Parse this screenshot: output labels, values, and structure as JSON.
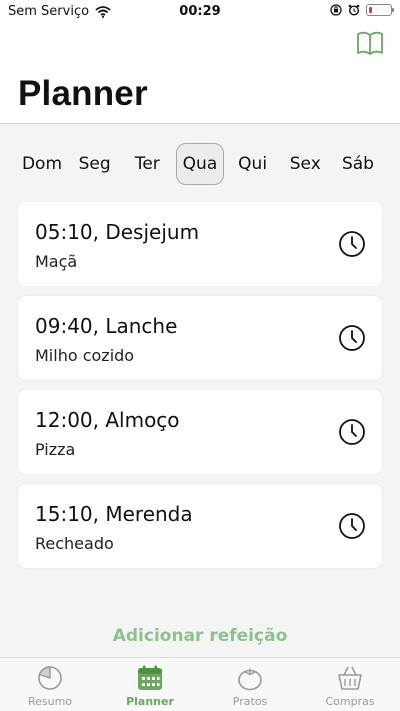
{
  "status_bar": {
    "carrier": "Sem Serviço",
    "time": "00:29"
  },
  "header": {
    "title": "Planner",
    "icon": "book-icon"
  },
  "days": [
    {
      "label": "Dom",
      "active": false
    },
    {
      "label": "Seg",
      "active": false
    },
    {
      "label": "Ter",
      "active": false
    },
    {
      "label": "Qua",
      "active": true
    },
    {
      "label": "Qui",
      "active": false
    },
    {
      "label": "Sex",
      "active": false
    },
    {
      "label": "Sáb",
      "active": false
    }
  ],
  "meals": [
    {
      "title": "05:10, Desjejum",
      "food": "Maçã"
    },
    {
      "title": "09:40, Lanche",
      "food": "Milho cozido"
    },
    {
      "title": "12:00, Almoço",
      "food": "Pizza"
    },
    {
      "title": "15:10, Merenda",
      "food": "Recheado"
    }
  ],
  "add_meal_label": "Adicionar refeição",
  "tabs": [
    {
      "label": "Resumo",
      "icon": "pie-chart-icon",
      "active": false
    },
    {
      "label": "Planner",
      "icon": "calendar-icon",
      "active": true
    },
    {
      "label": "Pratos",
      "icon": "tomato-icon",
      "active": false
    },
    {
      "label": "Compras",
      "icon": "basket-icon",
      "active": false
    }
  ],
  "colors": {
    "accent": "#6aa85f",
    "add_meal": "#8fc08f",
    "inactive": "#9a9a9a"
  }
}
